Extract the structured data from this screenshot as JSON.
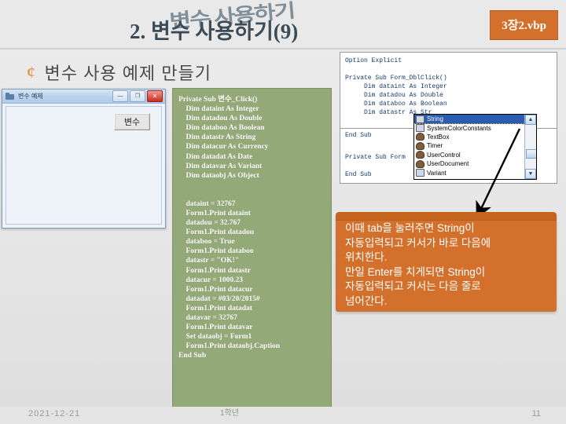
{
  "slide": {
    "title_main": "2. 변수 사용하기",
    "title_number": "(9)",
    "title_ghost": "변수 사용하기",
    "vbp_badge": "3장2.vbp",
    "bullet_glyph": "¢",
    "bullet_heading": "변수 사용 예제 만들기",
    "accent_orange": "#d2702c",
    "code_green": "#93a977",
    "title_color": "#3b4b57"
  },
  "vb_form": {
    "caption": "변수 예제",
    "icon": "form-icon",
    "minimize_label": "—",
    "maximize_label": "❐",
    "close_label": "✕",
    "button_label": "변수"
  },
  "code_block": {
    "lines": [
      "Private Sub 변수_Click()",
      "    Dim dataint As Integer",
      "    Dim datadou As Double",
      "    Dim databoo As Boolean",
      "    Dim datastr As String",
      "    Dim datacur As Currency",
      "    Dim datadat As Date",
      "    Dim datavar As Variant",
      "    Dim dataobj As Object",
      "",
      "",
      "    dataint = 32767",
      "    Form1.Print dataint",
      "    datadou = 32.767",
      "    Form1.Print datadou",
      "    databoo = True",
      "    Form1.Print databoo",
      "    datastr = \"OK!\"",
      "    Form1.Print datastr",
      "    datacur = 1000.23",
      "    Form1.Print datacur",
      "    datadat = #03/20/2015#",
      "    Form1.Print datadat",
      "    datavar = 32767",
      "    Form1.Print datavar",
      "    Set dataobj = Form1",
      "    Form1.Print dataobj.Caption",
      "End Sub"
    ]
  },
  "ide": {
    "code_top": "Option Explicit\n\nPrivate Sub Form_DblClick()\n     Dim dataint As Integer\n     Dim datadou As Double\n     Dim databoo As Boolean\n     Dim datastr As Str",
    "code_mid": "End Sub",
    "code_bottom": "Private Sub Form\n\nEnd Sub",
    "intellisense": {
      "items": [
        {
          "label": "String",
          "icon": "enum-icon",
          "selected": true
        },
        {
          "label": "SystemColorConstants",
          "icon": "enum-icon",
          "selected": false
        },
        {
          "label": "TextBox",
          "icon": "class-icon",
          "selected": false
        },
        {
          "label": "Timer",
          "icon": "class-icon",
          "selected": false
        },
        {
          "label": "UserControl",
          "icon": "class-icon",
          "selected": false
        },
        {
          "label": "UserDocument",
          "icon": "class-icon",
          "selected": false
        },
        {
          "label": "Variant",
          "icon": "enum-icon",
          "selected": false
        }
      ],
      "scroll_up": "▲",
      "scroll_down": "▼"
    }
  },
  "callout": {
    "text": "이때 tab을 눌러주면 String이\n자동입력되고 커서가 바로 다음에\n위치한다.\n만일 Enter를 치게되면 String이\n자동입력되고 커서는 다음 줄로\n넘어간다."
  },
  "footer": {
    "date": "2021-12-21",
    "center": "1학년",
    "page": "11"
  }
}
